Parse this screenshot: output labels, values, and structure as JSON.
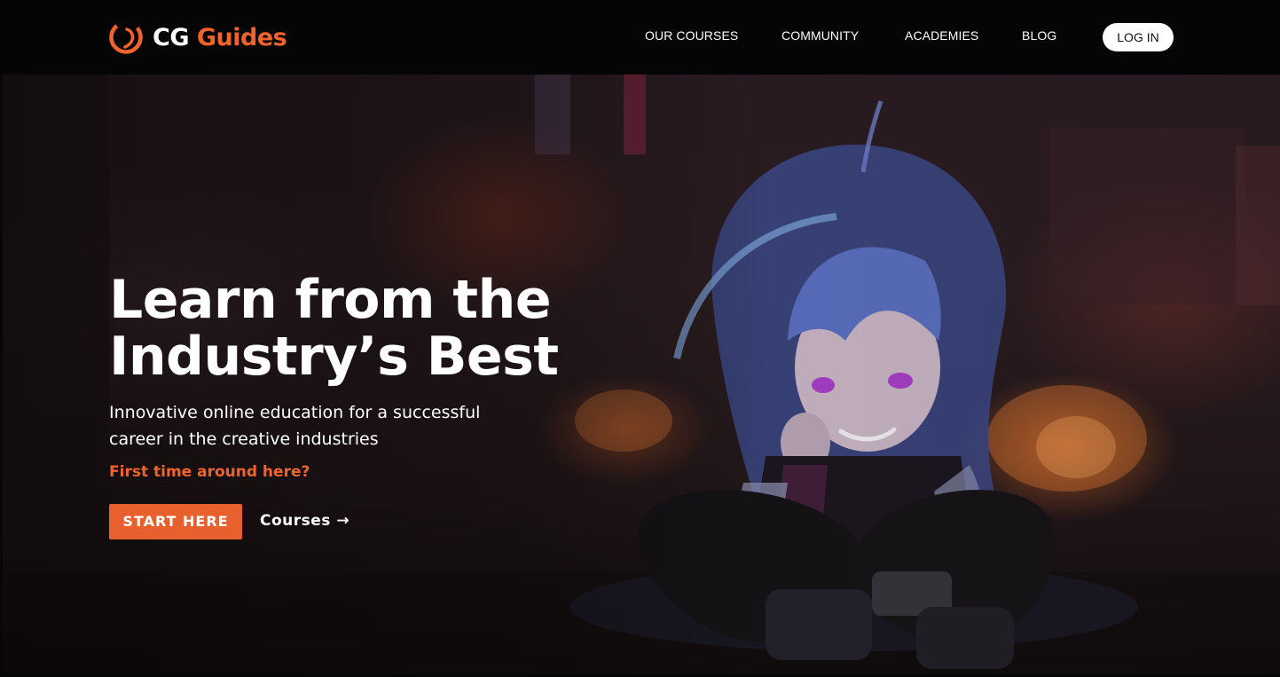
{
  "brand": {
    "name_part1": "CG",
    "name_part2": "Guides",
    "accent_color": "#f0642c",
    "icon": "cg-guides-logo-icon"
  },
  "nav": {
    "items": [
      {
        "label": "OUR COURSES"
      },
      {
        "label": "COMMUNITY"
      },
      {
        "label": "ACADEMIES"
      },
      {
        "label": "BLOG"
      }
    ],
    "login_label": "LOG IN"
  },
  "hero": {
    "title_line1": "Learn from the",
    "title_line2": "Industry’s Best",
    "subtitle": "Innovative online education for a successful career in the creative industries",
    "first_time_link": "First time around here?",
    "start_button": "START HERE",
    "courses_link": "Courses →",
    "button_color": "#e8602d"
  }
}
